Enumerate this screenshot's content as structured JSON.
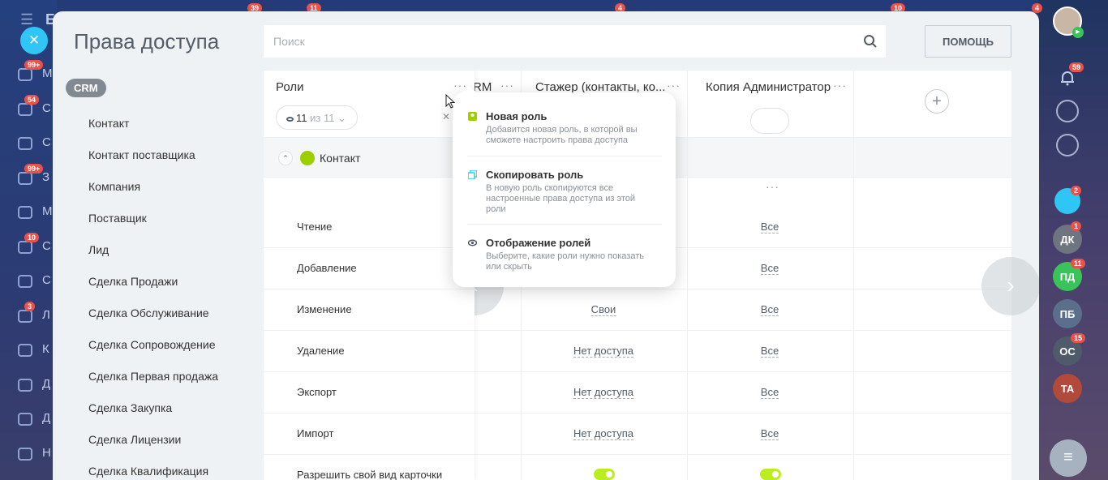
{
  "page": {
    "title": "Права доступа",
    "help_label": "ПОМОЩЬ"
  },
  "search": {
    "placeholder": "Поиск"
  },
  "crm_tag": "CRM",
  "categories": [
    "Контакт",
    "Контакт поставщика",
    "Компания",
    "Поставщик",
    "Лид",
    "Сделка Продажи",
    "Сделка Обслуживание",
    "Сделка Сопровождение",
    "Сделка Первая продажа",
    "Сделка Закупка",
    "Сделка Лицензии",
    "Сделка Квалификация"
  ],
  "table": {
    "roles_label": "Роли",
    "view_count": "11",
    "view_total": "из 11",
    "group_name": "Контакт",
    "columns": [
      {
        "name": "RM"
      },
      {
        "name": "Стажер (контакты, ко..."
      },
      {
        "name": "Копия Администратор"
      }
    ],
    "rows": [
      {
        "label": "Чтение",
        "col2": "",
        "col3": "Все"
      },
      {
        "label": "Добавление",
        "col2": "",
        "col3": "Все"
      },
      {
        "label": "Изменение",
        "col2": "Свои",
        "col3": "Все"
      },
      {
        "label": "Удаление",
        "col2": "Нет доступа",
        "col3": "Все"
      },
      {
        "label": "Экспорт",
        "col2": "Нет доступа",
        "col3": "Все"
      },
      {
        "label": "Импорт",
        "col2": "Нет доступа",
        "col3": "Все"
      },
      {
        "label": "Разрешить свой вид карточки",
        "col2_toggle": true,
        "col3_toggle": true
      }
    ]
  },
  "popup": {
    "items": [
      {
        "title": "Новая роль",
        "desc": "Добавится новая роль, в которой вы сможете настроить права доступа",
        "icon": "new-role-icon",
        "color": "#9dcf00"
      },
      {
        "title": "Скопировать роль",
        "desc": "В новую роль скопируются все настроенные права доступа из этой роли",
        "icon": "copy-icon",
        "color": "#2fc6f6"
      },
      {
        "title": "Отображение ролей",
        "desc": "Выберите, какие роли нужно показать или скрыть",
        "icon": "eye-icon",
        "color": "#535c69"
      }
    ]
  },
  "left_nav": {
    "items": [
      {
        "text": "М",
        "badge": "99+"
      },
      {
        "text": "С",
        "badge": "54"
      },
      {
        "text": "С",
        "badge": ""
      },
      {
        "text": "З",
        "badge": "99+"
      },
      {
        "text": "М",
        "badge": ""
      },
      {
        "text": "С",
        "badge": "10"
      },
      {
        "text": "С",
        "badge": ""
      },
      {
        "text": "Л",
        "badge": "3"
      },
      {
        "text": "К",
        "badge": ""
      },
      {
        "text": "Д",
        "badge": ""
      },
      {
        "text": "Д",
        "badge": ""
      },
      {
        "text": "Н",
        "badge": ""
      }
    ],
    "top_letter": "Б"
  },
  "top_badges": [
    "39",
    "11",
    "4",
    "10",
    "4"
  ],
  "right_bar": {
    "notif_badge": "59",
    "chat_badge": "2",
    "avatars": [
      {
        "initials": "ДК",
        "badge": "1",
        "color": "#6f7580"
      },
      {
        "initials": "ПД",
        "badge": "11",
        "color": "#3bc35b"
      },
      {
        "initials": "ПБ",
        "badge": "",
        "color": "#5b6f8c"
      },
      {
        "initials": "ОС",
        "badge": "15",
        "color": "#4f5a6b"
      },
      {
        "initials": "ТА",
        "badge": "",
        "color": "#b14a3a"
      }
    ]
  }
}
